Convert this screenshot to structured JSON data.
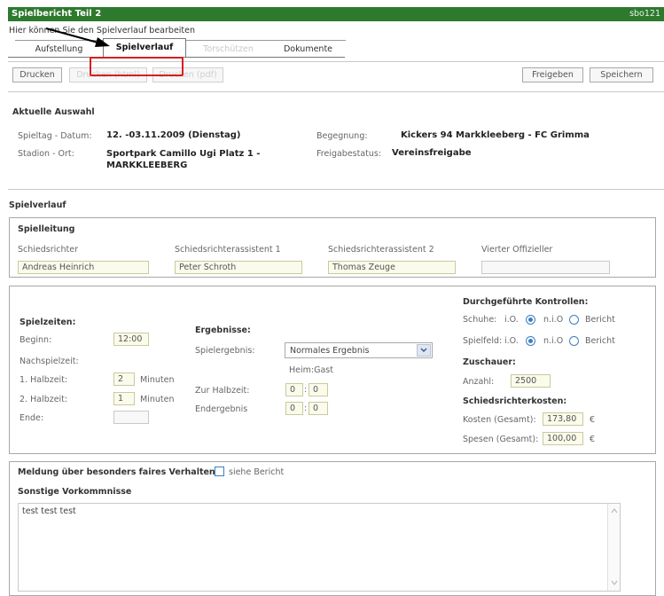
{
  "header": {
    "title": "Spielbericht Teil 2",
    "user": "sbo121"
  },
  "hint": "Hier können Sie den Spielverlauf bearbeiten",
  "tabs": [
    {
      "label": "Aufstellung"
    },
    {
      "label": "Spielverlauf"
    },
    {
      "label": "Torschützen"
    },
    {
      "label": "Dokumente"
    }
  ],
  "toolbar": {
    "print": "Drucken",
    "print_html": "Drucken (html)",
    "print_pdf": "Drucken (pdf)",
    "release": "Freigeben",
    "save": "Speichern"
  },
  "selection": {
    "title": "Aktuelle Auswahl",
    "date_label": "Spieltag - Datum:",
    "date_value": "12. -03.11.2009 (Dienstag)",
    "match_label": "Begegnung:",
    "match_value": "Kickers 94 Markkleeberg - FC Grimma",
    "stadium_label": "Stadion - Ort:",
    "stadium_value": "Sportpark Camillo Ugi Platz 1 - MARKKLEEBERG",
    "status_label": "Freigabestatus:",
    "status_value": "Vereinsfreigabe"
  },
  "course": {
    "title": "Spielverlauf",
    "officials": {
      "title": "Spielleitung",
      "referee_label": "Schiedsrichter",
      "referee": "Andreas Heinrich",
      "ar1_label": "Schiedsrichterassistent 1",
      "ar1": "Peter Schroth",
      "ar2_label": "Schiedsrichterassistent 2",
      "ar2": "Thomas Zeuge",
      "fourth_label": "Vierter Offizieller",
      "fourth": ""
    },
    "times": {
      "title": "Spielzeiten:",
      "start_label": "Beginn:",
      "start": "12:00",
      "extra_label": "Nachspielzeit:",
      "h1_label": "1. Halbzeit:",
      "h1": "2",
      "h2_label": "2. Halbzeit:",
      "h2": "1",
      "minutes": "Minuten",
      "end_label": "Ende:",
      "end": ""
    },
    "results": {
      "title": "Ergebnisse:",
      "result_label": "Spielergebnis:",
      "result_value": "Normales Ergebnis",
      "home_away": "Heim:Gast",
      "half_label": "Zur Halbzeit:",
      "half_home": "0",
      "half_away": "0",
      "final_label": "Endergebnis",
      "final_home": "0",
      "final_away": "0",
      "colon": ":"
    },
    "controls": {
      "title": "Durchgeführte Kontrollen:",
      "shoes_label": "Schuhe:",
      "field_label": "Spielfeld:",
      "ok": "i.O.",
      "not_ok": "n.i.O",
      "report": "Bericht"
    },
    "spectators": {
      "title": "Zuschauer:",
      "count_label": "Anzahl:",
      "count": "2500"
    },
    "costs": {
      "title": "Schiedsrichterkosten:",
      "total_label": "Kosten (Gesamt):",
      "total": "173,80",
      "expenses_label": "Spesen (Gesamt):",
      "expenses": "100,00",
      "currency": "€"
    },
    "fairplay": {
      "label": "Meldung über besonders faires Verhalten:",
      "note": "siehe Bericht"
    },
    "incidents": {
      "title": "Sonstige Vorkommnisse",
      "text": "test test test"
    }
  }
}
